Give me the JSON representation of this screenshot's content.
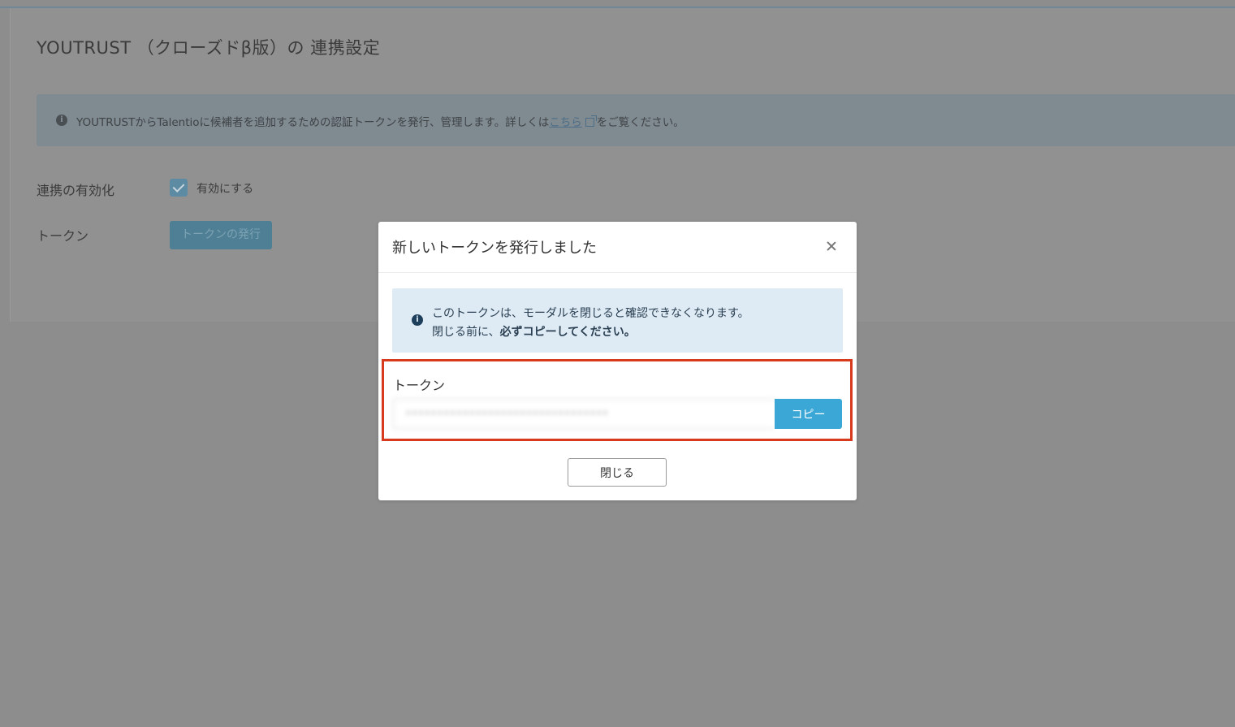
{
  "page": {
    "title": "YOUTRUST （クローズドβ版）の 連携設定",
    "info": {
      "text_before_link": "YOUTRUSTからTalentioに候補者を追加するための認証トークンを発行、管理します。詳しくは",
      "link_text": "こちら",
      "text_after_link": "をご覧ください。"
    },
    "enable_row": {
      "label": "連携の有効化",
      "checkbox_label": "有効にする",
      "checked": true
    },
    "token_row": {
      "label": "トークン",
      "issue_button_label": "トークンの発行"
    }
  },
  "modal": {
    "title": "新しいトークンを発行しました",
    "notice": {
      "line1": "このトークンは、モーダルを閉じると確認できなくなります。",
      "line2_prefix": "閉じる前に、",
      "line2_bold": "必ずコピーしてください。"
    },
    "token_field": {
      "label": "トークン",
      "value": "••••••••••••••••••••••••••••••••"
    },
    "copy_button_label": "コピー",
    "close_button_label": "閉じる"
  },
  "colors": {
    "overlay": "#8d8d8d",
    "accent": "#3aa7d6",
    "highlight_frame": "#d83a1e",
    "notice_background": "#deebf4"
  },
  "icons": {
    "info": "info-icon",
    "external_link": "external-link-icon",
    "checkbox": "check-icon",
    "close": "close-icon"
  }
}
